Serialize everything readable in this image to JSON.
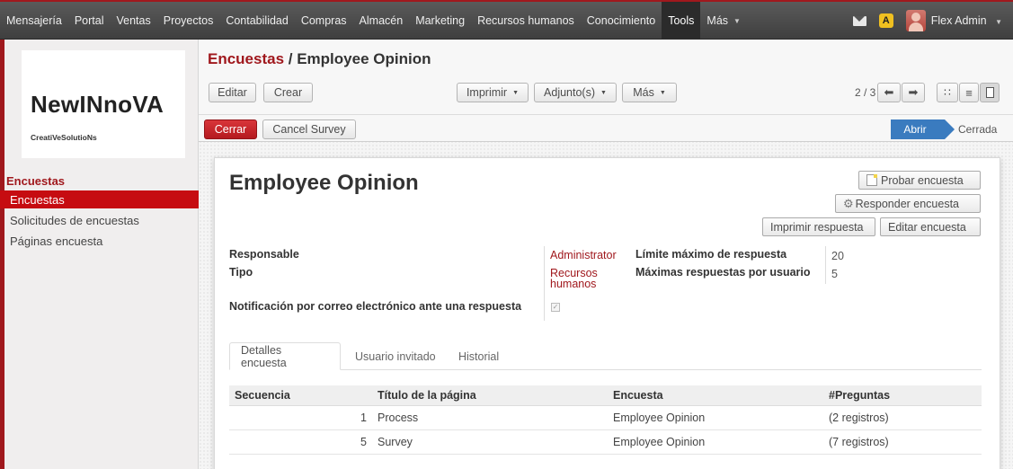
{
  "topbar": {
    "menu": [
      "Mensajería",
      "Portal",
      "Ventas",
      "Proyectos",
      "Contabilidad",
      "Compras",
      "Almacén",
      "Marketing",
      "Recursos humanos",
      "Conocimiento",
      "Tools",
      "Más"
    ],
    "active": "Tools",
    "badge_letter": "A",
    "user": "Flex Admin",
    "icons": [
      "envelope-icon",
      "chat-badge-icon",
      "avatar"
    ]
  },
  "sidebar": {
    "logo_main": "NewINnoVA",
    "logo_sub": "CreatiVeSolutioNs",
    "section": "Encuestas",
    "items": [
      "Encuestas",
      "Solicitudes de encuestas",
      "Páginas encuesta"
    ],
    "active_index": 0
  },
  "control_panel": {
    "breadcrumb_parent": "Encuestas",
    "breadcrumb_sep": " / ",
    "breadcrumb_current": "Employee Opinion",
    "edit": "Editar",
    "create": "Crear",
    "print": "Imprimir",
    "attachments": "Adjunto(s)",
    "more": "Más",
    "pager": "2 / 3",
    "close": "Cerrar",
    "cancel_survey": "Cancel Survey",
    "stages": [
      "Abrir",
      "Cerrada"
    ],
    "current_stage": "Abrir"
  },
  "form": {
    "title": "Employee Opinion",
    "buttons": {
      "test": "Probar encuesta",
      "answer": "Responder encuesta",
      "print_answer": "Imprimir respuesta",
      "edit_survey": "Editar encuesta"
    },
    "fields": {
      "responsible_label": "Responsable",
      "responsible_value": "Administrator",
      "type_label": "Tipo",
      "type_value_1": "Recursos",
      "type_value_2": "humanos",
      "notify_label": "Notificación por correo electrónico ante una respuesta",
      "notify_checked": true,
      "max_response_label": "Límite máximo de respuesta",
      "max_response_value": "20",
      "max_per_user_label": "Máximas respuestas por usuario",
      "max_per_user_value": "5"
    },
    "tabs": [
      "Detalles encuesta",
      "Usuario invitado",
      "Historial"
    ],
    "active_tab": 0,
    "table": {
      "headers": [
        "Secuencia",
        "Título de la página",
        "Encuesta",
        "#Preguntas"
      ],
      "rows": [
        {
          "seq": "1",
          "title": "Process",
          "survey": "Employee Opinion",
          "questions": "(2 registros)"
        },
        {
          "seq": "5",
          "title": "Survey",
          "survey": "Employee Opinion",
          "questions": "(7 registros)"
        }
      ]
    }
  },
  "colors": {
    "brand_red": "#a0181d",
    "active_red": "#c60c11",
    "stage_blue": "#3a7bbf",
    "topbar": "#4a4a4a"
  }
}
